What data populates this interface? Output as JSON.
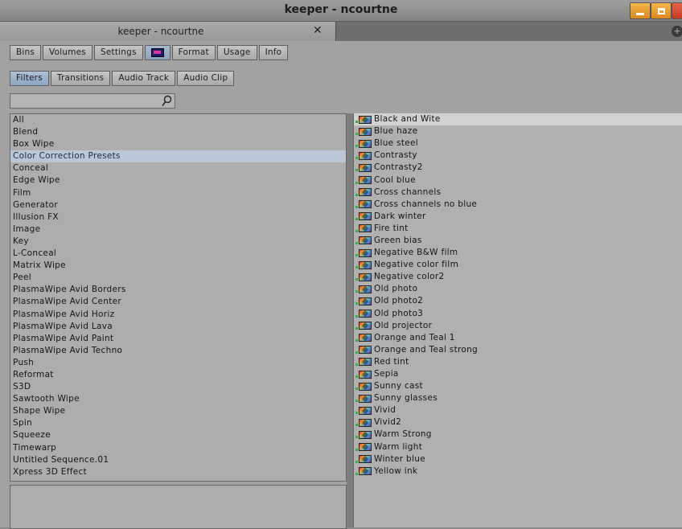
{
  "window": {
    "title": "keeper - ncourtne"
  },
  "tab": {
    "label": "keeper - ncourtne",
    "close_glyph": "✕",
    "add_glyph": "+"
  },
  "toolbar": {
    "items": [
      {
        "label": "Bins"
      },
      {
        "label": "Volumes"
      },
      {
        "label": "Settings"
      },
      {
        "label": "",
        "icon": "effect-palette-icon"
      },
      {
        "label": "Format"
      },
      {
        "label": "Usage"
      },
      {
        "label": "Info"
      }
    ]
  },
  "subtabs": {
    "items": [
      {
        "label": "Filters",
        "selected": true
      },
      {
        "label": "Transitions"
      },
      {
        "label": "Audio Track"
      },
      {
        "label": "Audio Clip"
      }
    ]
  },
  "search": {
    "value": "",
    "icon": "search-icon"
  },
  "categories": [
    "All",
    "Blend",
    "Box Wipe",
    "Color Correction Presets",
    "Conceal",
    "Edge Wipe",
    "Film",
    "Generator",
    "Illusion FX",
    "Image",
    "Key",
    "L-Conceal",
    "Matrix Wipe",
    "Peel",
    "PlasmaWipe Avid Borders",
    "PlasmaWipe Avid Center",
    "PlasmaWipe Avid Horiz",
    "PlasmaWipe Avid Lava",
    "PlasmaWipe Avid Paint",
    "PlasmaWipe Avid Techno",
    "Push",
    "Reformat",
    "S3D",
    "Sawtooth Wipe",
    "Shape Wipe",
    "Spin",
    "Squeeze",
    "Timewarp",
    "Untitled Sequence.01",
    "Xpress 3D Effect"
  ],
  "selected_category_index": 3,
  "effects": [
    "Black and Wite",
    "Blue haze",
    "Blue steel",
    "Contrasty",
    "Contrasty2",
    "Cool blue",
    "Cross channels",
    "Cross channels no blue",
    "Dark winter",
    "Fire tint",
    "Green bias",
    "Negative B&W film",
    "Negative color film",
    "Negative color2",
    "Old photo",
    "Old photo2",
    "Old photo3",
    "Old projector",
    "Orange and Teal 1",
    "Orange and Teal strong",
    "Red tint",
    "Sepia",
    "Sunny cast",
    "Sunny glasses",
    "Vivid",
    "Vivid2",
    "Warm Strong",
    "Warm light",
    "Winter blue",
    "Yellow ink"
  ],
  "selected_effect_index": 0,
  "colors": {
    "selection": "#b9c7d6",
    "accent_selected_tab": "#9db3cc",
    "minimize": "#e89a30",
    "close": "#d04a34"
  }
}
